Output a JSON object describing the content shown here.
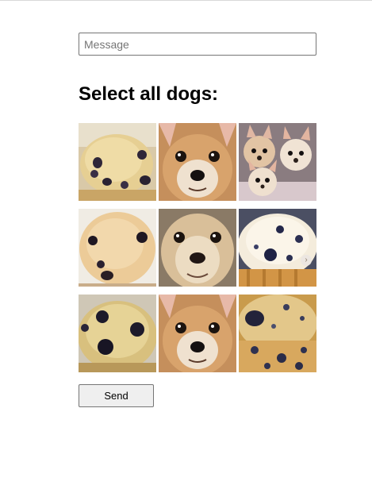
{
  "message": {
    "value": "",
    "placeholder": "Message"
  },
  "heading": "Select all dogs:",
  "tiles": [
    {
      "kind": "muffin"
    },
    {
      "kind": "dog"
    },
    {
      "kind": "dog"
    },
    {
      "kind": "muffin"
    },
    {
      "kind": "dog"
    },
    {
      "kind": "muffin"
    },
    {
      "kind": "muffin"
    },
    {
      "kind": "dog"
    },
    {
      "kind": "muffin"
    }
  ],
  "carousel_icon": "›",
  "send_label": "Send"
}
